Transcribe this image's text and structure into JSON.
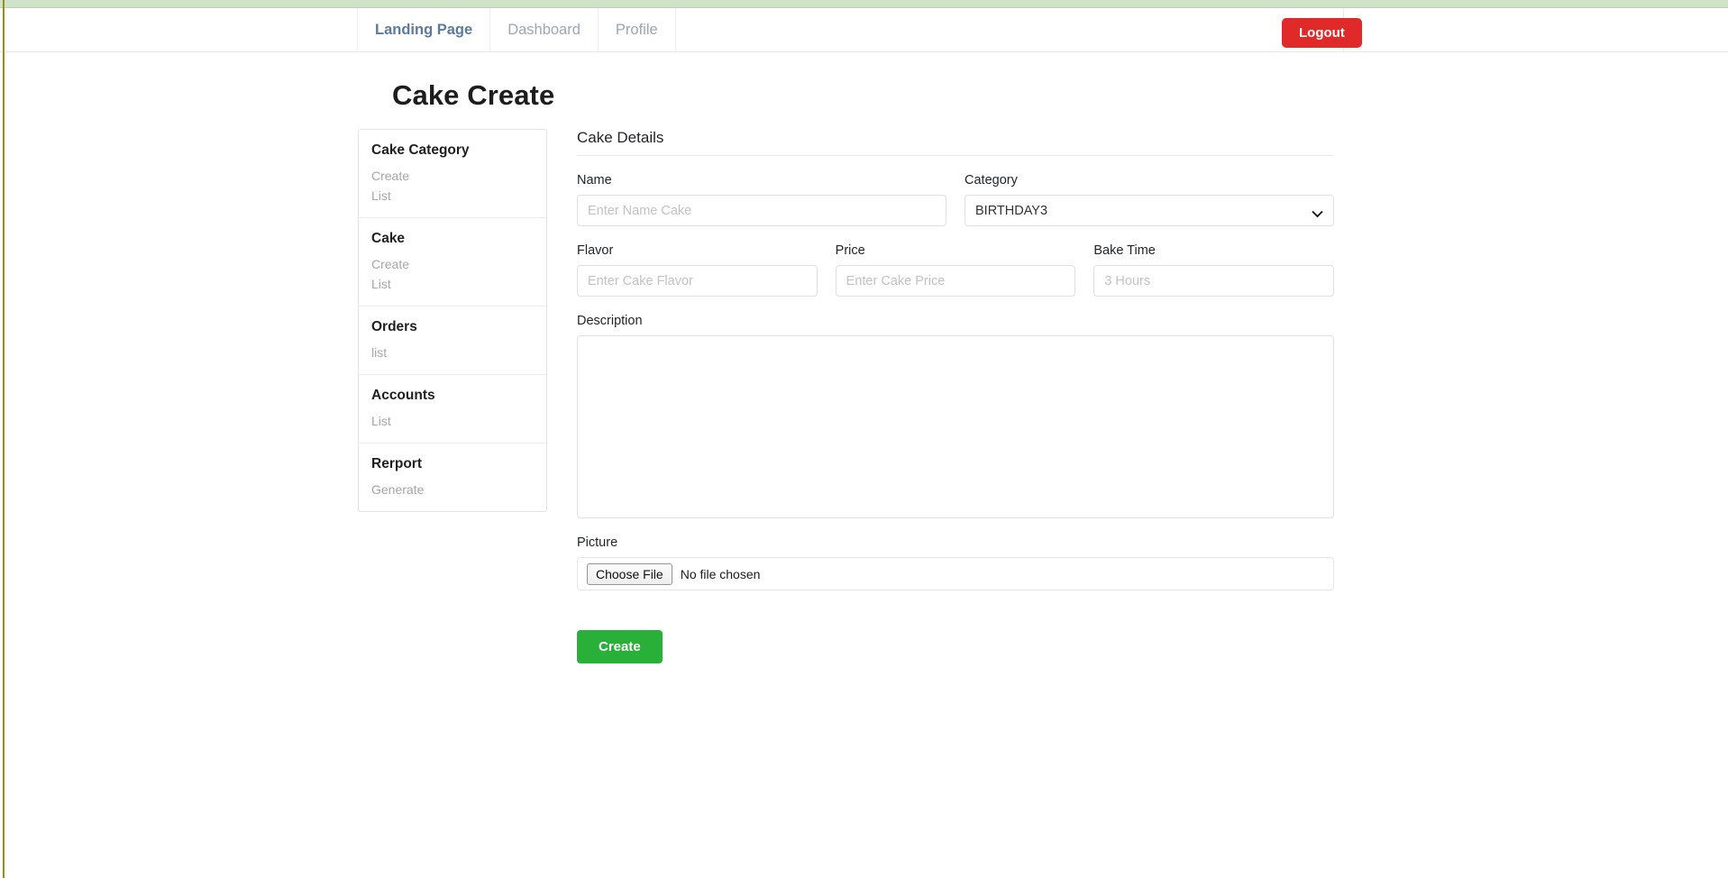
{
  "navbar": {
    "items": [
      {
        "label": "Landing Page",
        "active": true
      },
      {
        "label": "Dashboard",
        "active": false
      },
      {
        "label": "Profile",
        "active": false
      }
    ],
    "logout_label": "Logout"
  },
  "page": {
    "title": "Cake Create"
  },
  "sidebar": {
    "sections": [
      {
        "title": "Cake Category",
        "links": [
          "Create",
          "List"
        ]
      },
      {
        "title": "Cake",
        "links": [
          "Create",
          "List"
        ]
      },
      {
        "title": "Orders",
        "links": [
          "list"
        ]
      },
      {
        "title": "Accounts",
        "links": [
          "List"
        ]
      },
      {
        "title": "Rerport",
        "links": [
          "Generate"
        ]
      }
    ]
  },
  "form": {
    "heading": "Cake Details",
    "name": {
      "label": "Name",
      "placeholder": "Enter Name Cake",
      "value": ""
    },
    "category": {
      "label": "Category",
      "selected": "BIRTHDAY3",
      "options": [
        "BIRTHDAY3"
      ]
    },
    "flavor": {
      "label": "Flavor",
      "placeholder": "Enter Cake Flavor",
      "value": ""
    },
    "price": {
      "label": "Price",
      "placeholder": "Enter Cake Price",
      "value": ""
    },
    "bake_time": {
      "label": "Bake Time",
      "placeholder": "3 Hours",
      "value": ""
    },
    "description": {
      "label": "Description",
      "placeholder": "",
      "value": ""
    },
    "picture": {
      "label": "Picture",
      "choose_label": "Choose File",
      "status": "No file chosen"
    },
    "submit_label": "Create"
  },
  "colors": {
    "top_strip": "#cfe3c8",
    "edge_rule": "#9c8c13",
    "logout": "#e02a2a",
    "create": "#28b038",
    "nav_active": "#5c7a9e",
    "nav_muted": "#9aa7b4"
  }
}
